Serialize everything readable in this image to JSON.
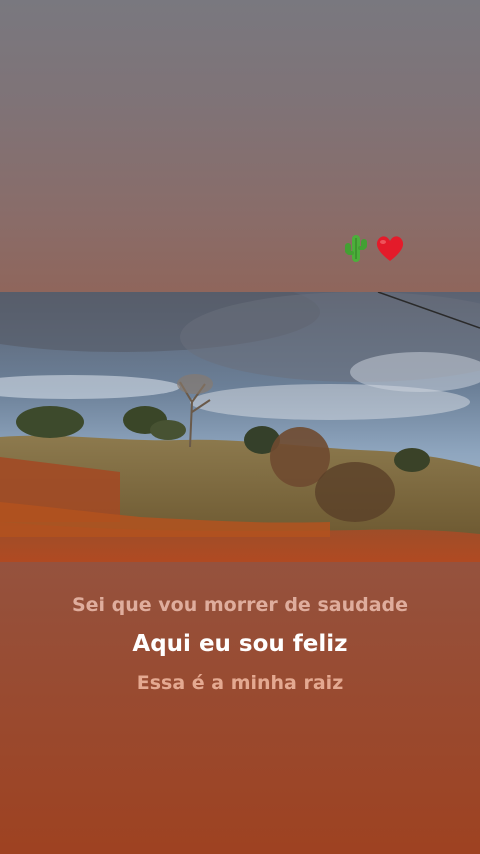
{
  "sticker": {
    "emojis": [
      "cactus-icon",
      "heart-icon"
    ],
    "heart_color": "#e41b2a",
    "cactus_color": "#4caf3b"
  },
  "lyrics": {
    "line1": "Sei que vou morrer de saudade",
    "line2": "Aqui eu sou feliz",
    "line3": "Essa é a minha raiz"
  },
  "colors": {
    "text_highlight": "#ffffff",
    "text_dim": "#e3b3a3"
  }
}
